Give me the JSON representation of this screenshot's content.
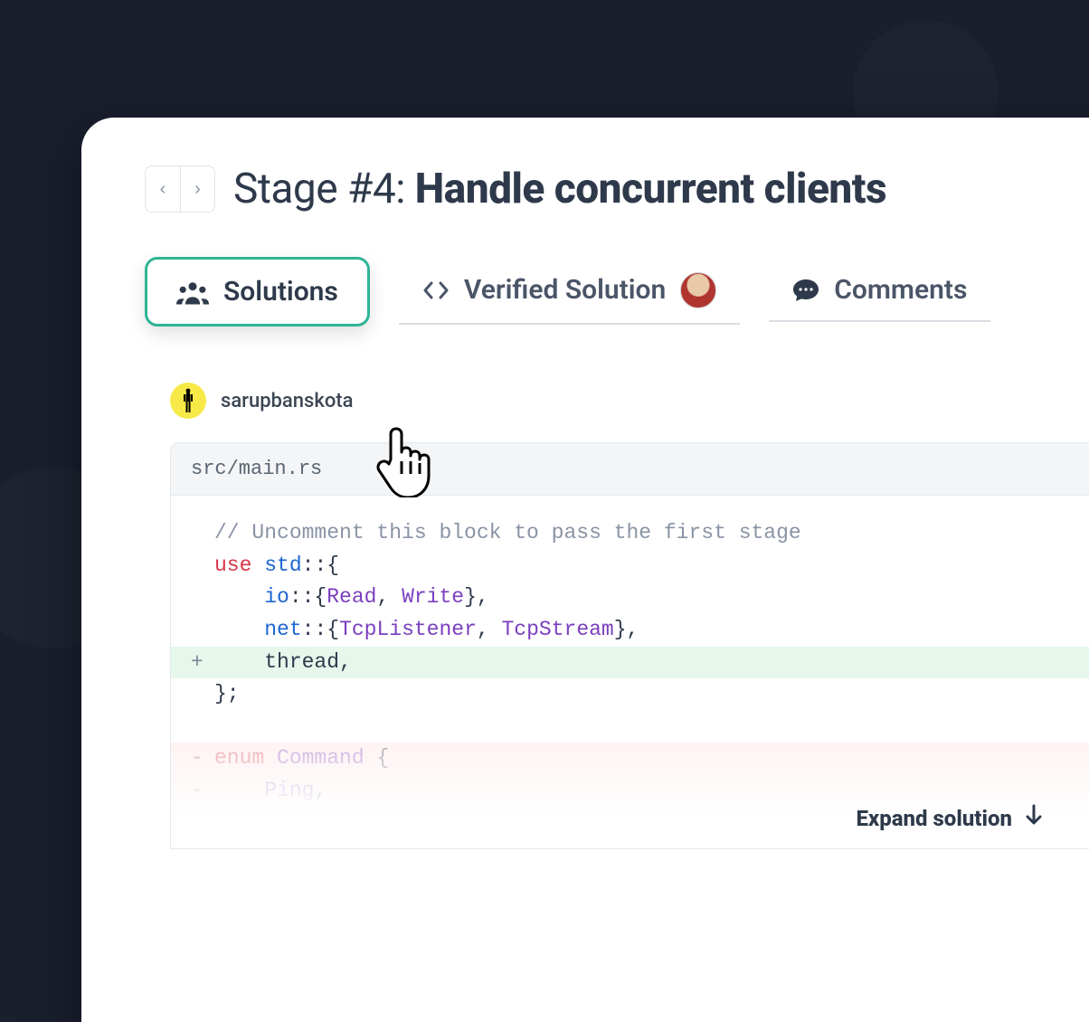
{
  "colors": {
    "accent": "#2fb597",
    "text": "#2e3a4b",
    "bg_dark": "#1a1f2e",
    "diff_added": "#e6f7ec",
    "diff_removed": "#fdeeee"
  },
  "header": {
    "stage_prefix": "Stage #4:",
    "stage_title": "Handle concurrent clients",
    "prev_label": "‹",
    "next_label": "›"
  },
  "tabs": {
    "solutions": {
      "label": "Solutions",
      "icon": "people-icon",
      "active": true
    },
    "verified": {
      "label": "Verified Solution",
      "icon": "code-icon"
    },
    "comments": {
      "label": "Comments",
      "icon": "chat-icon"
    }
  },
  "solution": {
    "author": "sarupbanskota",
    "file": "src/main.rs",
    "expand_label": "Expand solution",
    "code_lines": [
      {
        "kind": "ctx",
        "gutter": " ",
        "tokens": [
          {
            "t": "// Uncomment this block to pass the first stage",
            "c": "comment"
          }
        ]
      },
      {
        "kind": "ctx",
        "gutter": " ",
        "tokens": [
          {
            "t": "use ",
            "c": "kw"
          },
          {
            "t": "std",
            "c": "ns"
          },
          {
            "t": "::{",
            "c": "punct"
          }
        ]
      },
      {
        "kind": "ctx",
        "gutter": " ",
        "tokens": [
          {
            "t": "    ",
            "c": "punct"
          },
          {
            "t": "io",
            "c": "ns"
          },
          {
            "t": "::{",
            "c": "punct"
          },
          {
            "t": "Read",
            "c": "type"
          },
          {
            "t": ", ",
            "c": "punct"
          },
          {
            "t": "Write",
            "c": "type"
          },
          {
            "t": "},",
            "c": "punct"
          }
        ]
      },
      {
        "kind": "ctx",
        "gutter": " ",
        "tokens": [
          {
            "t": "    ",
            "c": "punct"
          },
          {
            "t": "net",
            "c": "ns"
          },
          {
            "t": "::{",
            "c": "punct"
          },
          {
            "t": "TcpListener",
            "c": "type"
          },
          {
            "t": ", ",
            "c": "punct"
          },
          {
            "t": "TcpStream",
            "c": "type"
          },
          {
            "t": "},",
            "c": "punct"
          }
        ]
      },
      {
        "kind": "added",
        "gutter": "+",
        "tokens": [
          {
            "t": "    thread,",
            "c": "punct"
          }
        ]
      },
      {
        "kind": "ctx",
        "gutter": " ",
        "tokens": [
          {
            "t": "};",
            "c": "punct"
          }
        ]
      },
      {
        "kind": "blank",
        "gutter": " ",
        "tokens": []
      },
      {
        "kind": "removed",
        "gutter": "-",
        "tokens": [
          {
            "t": "enum ",
            "c": "kw"
          },
          {
            "t": "Command",
            "c": "type"
          },
          {
            "t": " {",
            "c": "punct"
          }
        ]
      },
      {
        "kind": "removed",
        "gutter": "-",
        "tokens": [
          {
            "t": "    ",
            "c": "punct"
          },
          {
            "t": "Ping",
            "c": "type"
          },
          {
            "t": ",",
            "c": "punct"
          }
        ]
      },
      {
        "kind": "removed",
        "gutter": " ",
        "tokens": [
          {
            "t": "}",
            "c": "punct"
          }
        ]
      }
    ]
  }
}
